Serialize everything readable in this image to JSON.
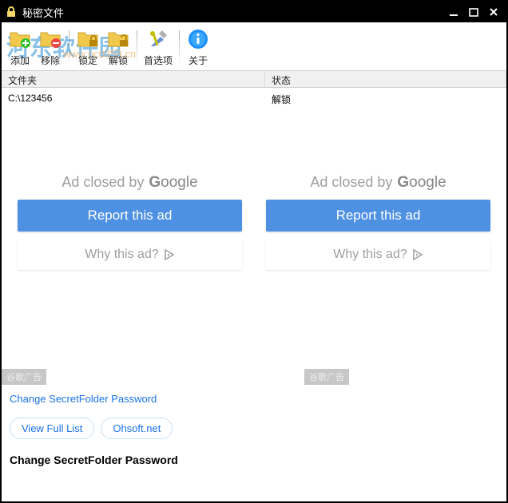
{
  "window": {
    "title": "秘密文件"
  },
  "watermark": {
    "text": "河东软件园",
    "url": "www.pc0359.cn"
  },
  "toolbar": {
    "add": "添加",
    "remove": "移除",
    "lock": "锁定",
    "unlock": "解锁",
    "prefs": "首选项",
    "about": "关于"
  },
  "table": {
    "columns": {
      "folder": "文件夹",
      "status": "状态"
    },
    "rows": [
      {
        "folder": "C:\\123456",
        "status": "解锁"
      }
    ]
  },
  "ads": {
    "closed_prefix": "Ad closed by",
    "google": "Google",
    "report": "Report this ad",
    "why": "Why this ad?",
    "gad_label": "谷歌广告"
  },
  "links": {
    "change_pw": "Change SecretFolder Password",
    "view_full": "View Full List",
    "ohsoft": "Ohsoft.net",
    "change_pw_bold": "Change SecretFolder Password"
  }
}
